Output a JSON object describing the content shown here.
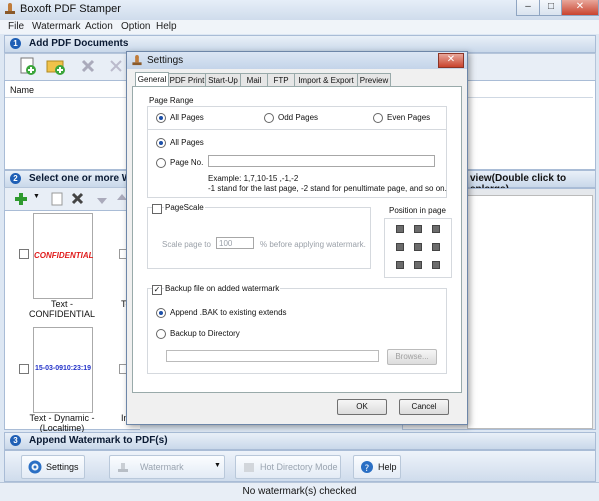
{
  "window": {
    "title": "Boxoft PDF Stamper"
  },
  "menu": [
    "File",
    "Watermark",
    "Action",
    "Option",
    "Help"
  ],
  "section1": {
    "num": "1",
    "label": "Add PDF Documents"
  },
  "list": {
    "column_name": "Name"
  },
  "section2": {
    "num": "2",
    "label": "Select one or more Wate",
    "preview_label": "view(Double click to enlarge)"
  },
  "watermarks": [
    {
      "thumb_text": "CONFIDENTIAL",
      "caption": "Text - CONFIDENTIAL"
    },
    {
      "thumb_text": "15-03-0910:23:19",
      "caption": "Text - Dynamic - (Localtime)"
    }
  ],
  "partial_captions": [
    "Te",
    "Im"
  ],
  "section3": {
    "num": "3",
    "label": "Append Watermark to PDF(s)"
  },
  "bottom_buttons": {
    "settings": "Settings",
    "watermark": "Watermark",
    "hot_dir": "Hot Directory Mode",
    "help": "Help"
  },
  "status": "No watermark(s) checked",
  "dialog": {
    "title": "Settings",
    "tabs": [
      "General",
      "PDF Print",
      "Start-Up",
      "Mail",
      "FTP",
      "Import & Export",
      "Preview"
    ],
    "page_range": {
      "label": "Page Range",
      "options": [
        "All Pages",
        "Odd Pages",
        "Even Pages"
      ],
      "all_pages": "All Pages",
      "page_no": "Page No.",
      "page_no_value": "",
      "example": "Example: 1,7,10-15 ,-1,-2",
      "example_note": "-1 stand for the last page, -2 stand for penultimate page, and so on."
    },
    "page_scale": {
      "label": "PageScale",
      "checked": false,
      "scale_to": "Scale page to",
      "value": "100",
      "suffix": "% before applying watermark."
    },
    "position": {
      "label": "Position in page"
    },
    "backup": {
      "label": "Backup file on added watermark",
      "checked": true,
      "append": "Append .BAK to existing extends",
      "to_directory": "Backup to Directory",
      "directory_value": "",
      "browse": "Browse..."
    },
    "ok": "OK",
    "cancel": "Cancel"
  }
}
